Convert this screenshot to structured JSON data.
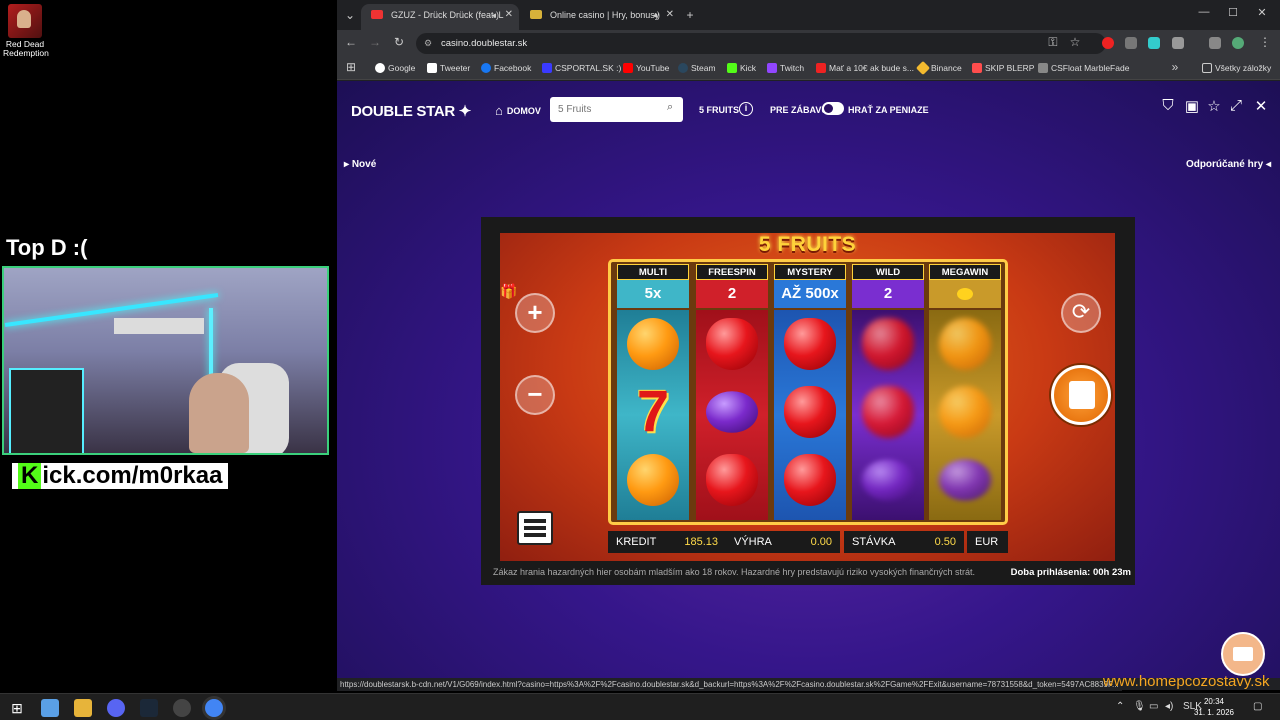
{
  "desktop": {
    "icon_label": "Red Dead Redemption",
    "streamer_title": "Top D :(",
    "kick_k": "K",
    "kick_rest": "ick.com/m0rkaa"
  },
  "browser": {
    "tabs": [
      {
        "title": "GZUZ - Drück Drück (feat. L",
        "active": true
      },
      {
        "title": "Online casino | Hry, bonusy",
        "active": false
      }
    ],
    "url": "casino.doublestar.sk",
    "bookmarks": [
      {
        "label": "Google",
        "color": "#ffffff"
      },
      {
        "label": "Tweeter",
        "color": "#ffffff"
      },
      {
        "label": "Facebook",
        "color": "#1877f2"
      },
      {
        "label": "CSPORTAL.SK :)",
        "color": "#3a3aff"
      },
      {
        "label": "YouTube",
        "color": "#ff0000"
      },
      {
        "label": "Steam",
        "color": "#1b2838"
      },
      {
        "label": "Kick",
        "color": "#53fc18"
      },
      {
        "label": "Twitch",
        "color": "#9146ff"
      },
      {
        "label": "Mať a 10€ ak bude s...",
        "color": "#e22"
      },
      {
        "label": "Binance",
        "color": "#f3ba2f"
      },
      {
        "label": "SKIP BLERP",
        "color": "#ff4d4d"
      },
      {
        "label": "CSFloat MarbleFade",
        "color": "#888888"
      }
    ],
    "all_bookmarks": "Všetky záložky",
    "status_url": "https://doublestarsk.b-cdn.net/V1/G069/index.html?casino=https%3A%2F%2Fcasino.doublestar.sk&d_backurl=https%3A%2F%2Fcasino.doublestar.sk%2FGame%2FExit&username=78731558&d_token=5497AC8839F..."
  },
  "site": {
    "logo": "DOUBLE STAR",
    "home": "DOMOV",
    "search_placeholder": "5 Fruits",
    "game_name": "5 FRUITS",
    "mode_free": "PRE ZÁBAVU",
    "mode_money": "HRAŤ ZA PENIAZE",
    "new_label": "Nové",
    "recommended_label": "Odporúčané hry",
    "disclaimer": "Zákaz hrania hazardných hier osobám mladším ako 18 rokov. Hazardné hry predstavujú riziko vysokých finančných strát.",
    "session": "Doba prihlásenia: 00h 23m"
  },
  "game": {
    "title": "5 FRUITS",
    "reels": [
      {
        "name": "MULTI",
        "value": "5x",
        "head_color": "#3fb6c8",
        "body_color": "#1f7e96",
        "symbols": [
          "orange",
          "seven",
          "orange"
        ]
      },
      {
        "name": "FREESPIN",
        "value": "2",
        "head_color": "#d0202a",
        "body_color": "#a0101a",
        "symbols": [
          "apple",
          "plum",
          "apple"
        ]
      },
      {
        "name": "MYSTERY",
        "value": "AŽ 500x",
        "head_color": "#2a78d8",
        "body_color": "#1d55b0",
        "symbols": [
          "apple",
          "apple",
          "apple"
        ]
      },
      {
        "name": "WILD",
        "value": "2",
        "head_color": "#7a2ed0",
        "body_color": "#3c1070",
        "symbols": [
          "apple",
          "apple",
          "plum"
        ]
      },
      {
        "name": "MEGAWIN",
        "value": "",
        "head_color": "#c99a2a",
        "body_color": "#8a6a12",
        "symbols": [
          "orange",
          "orange",
          "plum"
        ]
      }
    ],
    "credit_label": "KREDIT",
    "credit_value": "185.13",
    "win_label": "VÝHRA",
    "win_value": "0.00",
    "bet_label": "STÁVKA",
    "bet_value": "0.50",
    "currency": "EUR"
  },
  "watermark": "www.homepcozostavy.sk",
  "clock": {
    "time": "20:34",
    "date": "31. 1. 2026"
  },
  "taskbar": {
    "lang": "SLK"
  }
}
